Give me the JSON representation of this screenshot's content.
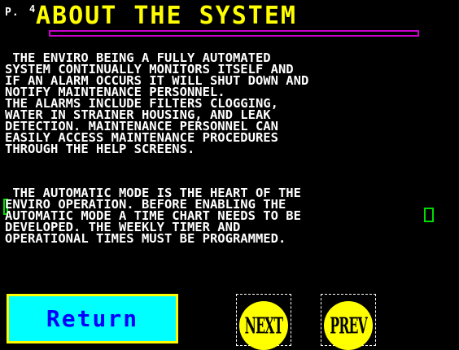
{
  "header": {
    "page_prefix": "P.",
    "page_number": "4",
    "title": "ABOUT THE SYSTEM"
  },
  "body": {
    "paragraph_1": " THE ENVIRO BEING A FULLY AUTOMATED\nSYSTEM CONTINUALLY MONITORS ITSELF AND\nIF AN ALARM OCCURS IT WILL SHUT DOWN AND\nNOTIFY MAINTENANCE PERSONNEL.\nTHE ALARMS INCLUDE FILTERS CLOGGING,\nWATER IN STRAINER HOUSING, AND LEAK\nDETECTION. MAINTENANCE PERSONNEL CAN\nEASILY ACCESS MAINTENANCE PROCEDURES\nTHROUGH THE HELP SCREENS.",
    "paragraph_2": " THE AUTOMATIC MODE IS THE HEART OF THE\nENVIRO OPERATION. BEFORE ENABLING THE\nAUTOMATIC MODE A TIME CHART NEEDS TO BE\nDEVELOPED. THE WEEKLY TIMER AND\nOPERATIONAL TIMES MUST BE PROGRAMMED."
  },
  "buttons": {
    "return_label": "Return",
    "next_label": "NEXT",
    "prev_label": "PREV"
  },
  "colors": {
    "background": "#000000",
    "title": "#ffff00",
    "title_underline": "#cc00cc",
    "body_text": "#ffffff",
    "return_bg": "#00ffff",
    "return_border": "#ffff00",
    "return_text": "#0000ff",
    "nav_circle": "#ffff00",
    "marker": "#00dd00"
  }
}
